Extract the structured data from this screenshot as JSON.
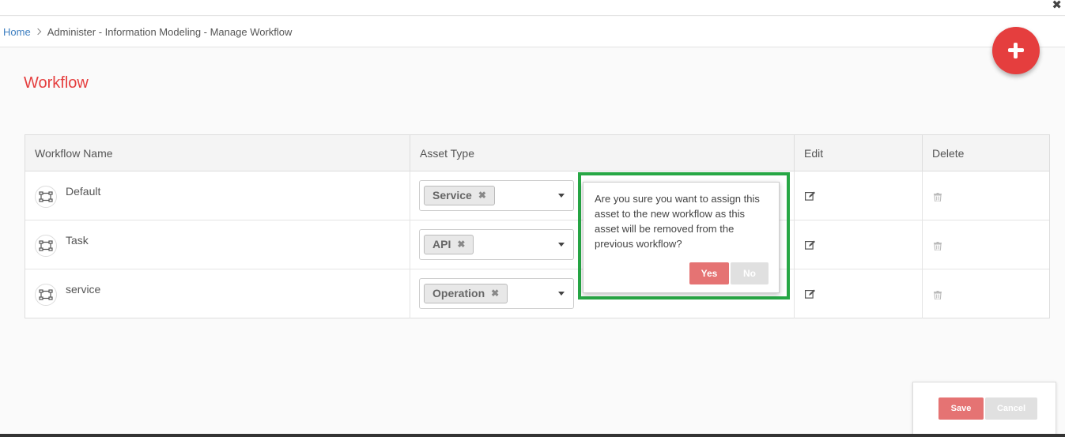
{
  "window": {
    "close_glyph": "✖"
  },
  "breadcrumb": {
    "home": "Home",
    "path": "Administer - Information Modeling - Manage Workflow"
  },
  "page": {
    "title": "Workflow"
  },
  "table": {
    "headers": {
      "name": "Workflow Name",
      "asset_type": "Asset Type",
      "edit": "Edit",
      "delete": "Delete"
    },
    "rows": [
      {
        "name": "Default",
        "asset_type": "Service",
        "remove_glyph": "✖"
      },
      {
        "name": "Task",
        "asset_type": "API",
        "remove_glyph": "✖"
      },
      {
        "name": "service",
        "asset_type": "Operation",
        "remove_glyph": "✖"
      }
    ]
  },
  "confirm": {
    "message": "Are you sure you want to assign this asset to the new workflow as this asset will be removed from the previous workflow?",
    "yes": "Yes",
    "no": "No"
  },
  "footer": {
    "save": "Save",
    "cancel": "Cancel"
  },
  "colors": {
    "accent": "#e53e3e",
    "button_primary": "#e57373",
    "button_disabled": "#e0e0e0",
    "link": "#3c7ec0",
    "highlight": "#27a745"
  },
  "icons": {
    "add": "plus-icon",
    "workflow": "workflow-icon",
    "edit": "edit-icon",
    "delete": "trash-icon",
    "chevron": "chevron-right-icon",
    "caret": "caret-down-icon"
  }
}
